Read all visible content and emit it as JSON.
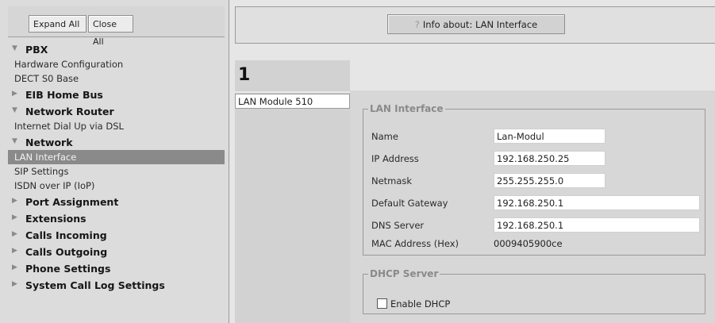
{
  "sidebar": {
    "expand_all": "Expand All",
    "close_all": "Close All",
    "sections": [
      {
        "title": "PBX",
        "expanded": true,
        "items": [
          "Hardware Configuration",
          "DECT S0 Base"
        ]
      },
      {
        "title": "EIB Home Bus",
        "expanded": false,
        "items": []
      },
      {
        "title": "Network Router",
        "expanded": true,
        "items": [
          "Internet Dial Up via DSL"
        ]
      },
      {
        "title": "Network",
        "expanded": true,
        "items": [
          "LAN Interface",
          "SIP Settings",
          "ISDN over IP (IoP)"
        ],
        "selected": "LAN Interface"
      },
      {
        "title": "Port Assignment",
        "expanded": false,
        "items": []
      },
      {
        "title": "Extensions",
        "expanded": false,
        "items": []
      },
      {
        "title": "Calls Incoming",
        "expanded": false,
        "items": []
      },
      {
        "title": "Calls Outgoing",
        "expanded": false,
        "items": []
      },
      {
        "title": "Phone Settings",
        "expanded": false,
        "items": []
      },
      {
        "title": "System Call Log Settings",
        "expanded": false,
        "items": []
      }
    ]
  },
  "header": {
    "info_button": "Info about: LAN Interface"
  },
  "modules": {
    "number": "1",
    "selected_module": "LAN Module 510"
  },
  "lan": {
    "legend": "LAN Interface",
    "name_label": "Name",
    "name_value": "Lan-Modul",
    "ip_label": "IP Address",
    "ip_value": "192.168.250.25",
    "netmask_label": "Netmask",
    "netmask_value": "255.255.255.0",
    "gateway_label": "Default Gateway",
    "gateway_value": "192.168.250.1",
    "dns_label": "DNS Server",
    "dns_value": "192.168.250.1",
    "mac_label": "MAC Address (Hex)",
    "mac_value": "0009405900ce"
  },
  "dhcp": {
    "legend": "DHCP Server",
    "enable_label": "Enable DHCP",
    "enabled": false
  }
}
